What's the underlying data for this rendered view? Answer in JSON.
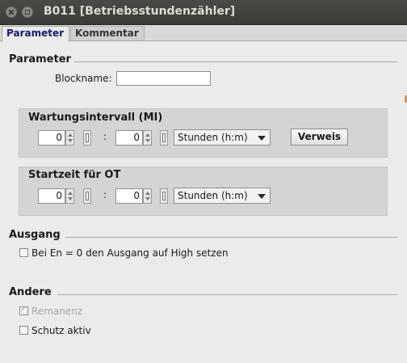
{
  "window": {
    "title": "B011 [Betriebsstundenzähler]"
  },
  "tabs": [
    {
      "label": "Parameter"
    },
    {
      "label": "Kommentar"
    }
  ],
  "parameter": {
    "heading": "Parameter",
    "blockname_label": "Blockname:",
    "blockname_value": "",
    "maintenance": {
      "title": "Wartungsintervall (MI)",
      "hours": "0",
      "minutes": "0",
      "separator": ":",
      "unit": "Stunden (h:m)",
      "button": "Verweis"
    },
    "start": {
      "title": "Startzeit für OT",
      "hours": "0",
      "minutes": "0",
      "separator": ":",
      "unit": "Stunden (h:m)"
    }
  },
  "ausgang": {
    "heading": "Ausgang",
    "checkbox_label": "Bei En = 0 den Ausgang auf High setzen",
    "checked": false
  },
  "andere": {
    "heading": "Andere",
    "remanenz_label": "Remanenz",
    "remanenz_checked": true,
    "remanenz_disabled": true,
    "schutz_label": "Schutz aktiv",
    "schutz_checked": false
  }
}
